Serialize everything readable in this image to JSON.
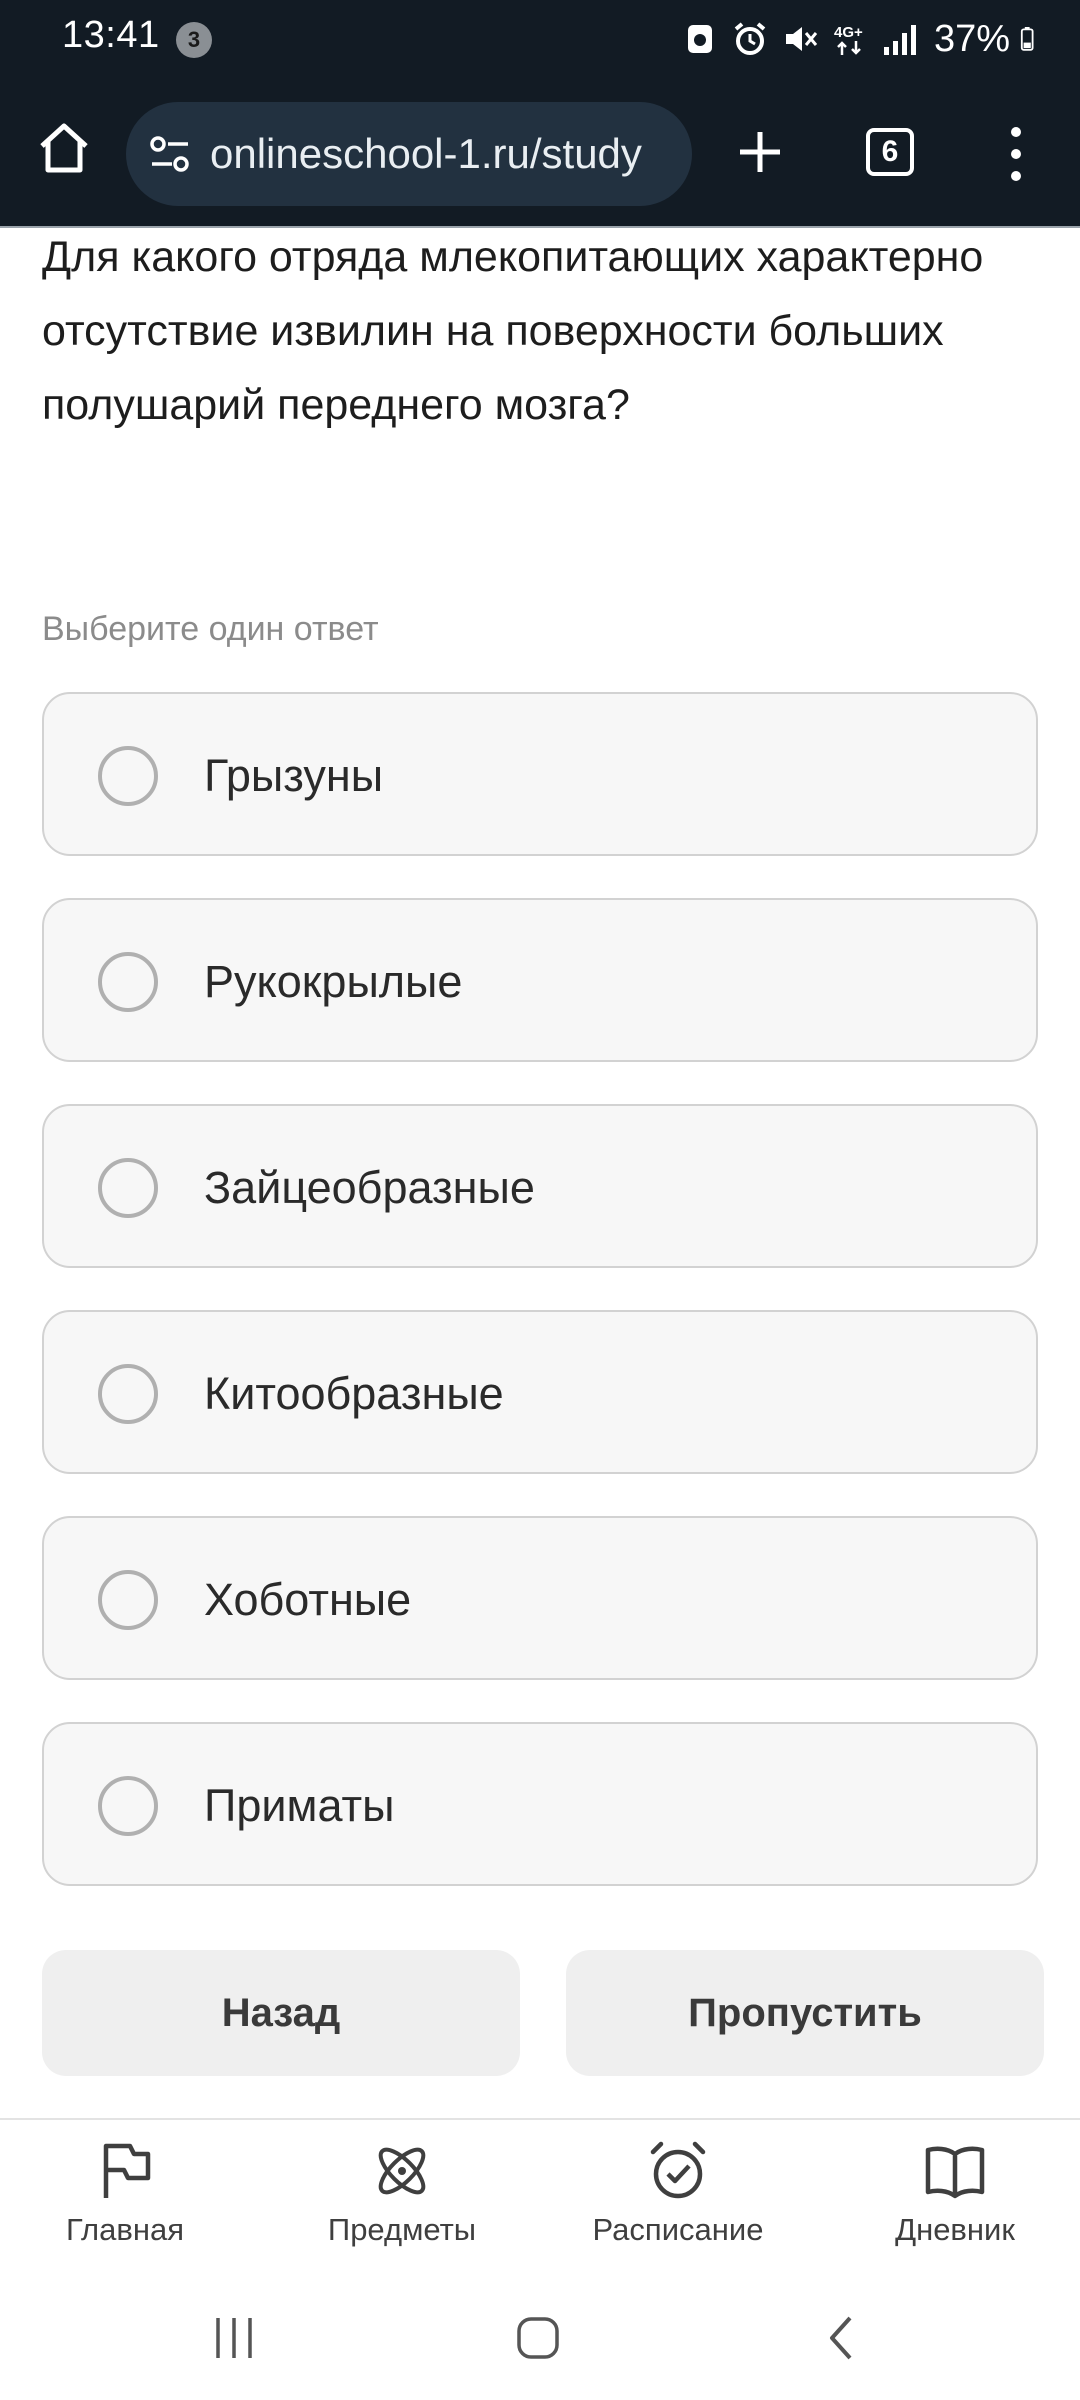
{
  "status_bar": {
    "time": "13:41",
    "notification_count": "3",
    "network": "4G+",
    "battery": "37%",
    "icons": [
      "app-notification-icon",
      "alarm-icon",
      "mute-icon",
      "network-4g-icon",
      "signal-icon",
      "battery-icon"
    ]
  },
  "browser": {
    "url": "onlineschool-1.ru/study",
    "tab_count": "6"
  },
  "quiz": {
    "question": "Для какого отряда млекопитающих характерно отсутствие извилин на поверхности больших полушарий переднего мозга?",
    "hint": "Выберите один ответ",
    "options": [
      {
        "label": "Грызуны",
        "selected": false
      },
      {
        "label": "Рукокрылые",
        "selected": false
      },
      {
        "label": "Зайцеобразные",
        "selected": false
      },
      {
        "label": "Китообразные",
        "selected": false
      },
      {
        "label": "Хоботные",
        "selected": false
      },
      {
        "label": "Приматы",
        "selected": false
      }
    ],
    "back_label": "Назад",
    "skip_label": "Пропустить"
  },
  "bottom_nav": {
    "items": [
      {
        "label": "Главная",
        "icon": "flag-icon"
      },
      {
        "label": "Предметы",
        "icon": "atom-icon"
      },
      {
        "label": "Расписание",
        "icon": "alarm-clock-icon"
      },
      {
        "label": "Дневник",
        "icon": "open-book-icon"
      }
    ]
  },
  "colors": {
    "status_bar_bg": "#121b24",
    "url_box_bg": "#223140",
    "option_bg": "#f7f7f7",
    "option_border": "#d2d2d2",
    "button_bg": "#efefef"
  }
}
